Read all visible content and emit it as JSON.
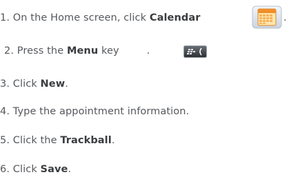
{
  "steps": [
    {
      "number": "1.",
      "before": "On the Home screen, click ",
      "bold": "Calendar",
      "after": "",
      "icon": "calendar-icon"
    },
    {
      "number": "2.",
      "before": "Press the ",
      "bold": "Menu",
      "after": " key",
      "icon": "menu-key-icon",
      "after_icon": "."
    },
    {
      "number": "3.",
      "before": "Click ",
      "bold": "New",
      "after": "."
    },
    {
      "number": "4.",
      "before": "Type the appointment information.",
      "bold": "",
      "after": ""
    },
    {
      "number": "5.",
      "before": "Click the ",
      "bold": "Trackball",
      "after": "."
    },
    {
      "number": "6.",
      "before": "Click ",
      "bold": "Save",
      "after": "."
    }
  ],
  "trailing_period": "."
}
